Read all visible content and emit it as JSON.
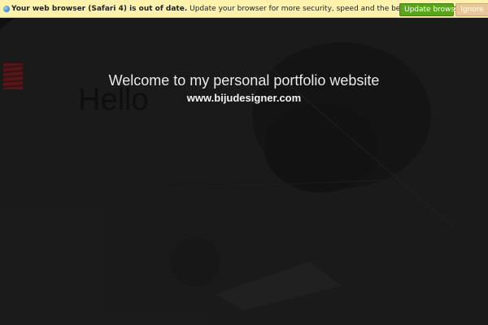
{
  "notice": {
    "icon": "browser-globe-icon",
    "bold_text": "Your web browser (Safari 4) is out of date.",
    "text": " Update your browser for more security, speed and the best experience on this site.",
    "update_label": "Update browser",
    "ignore_label": "Ignore",
    "colors": {
      "bar": "#fdf2ab",
      "update": "#5aa51c",
      "ignore": "#e8c89b"
    }
  },
  "background": {
    "hello_text": "Hello",
    "logo": "red-striped-logo"
  },
  "overlay": {
    "welcome": "Welcome to my personal portfolio website",
    "url": "www.bijudesigner.com"
  }
}
